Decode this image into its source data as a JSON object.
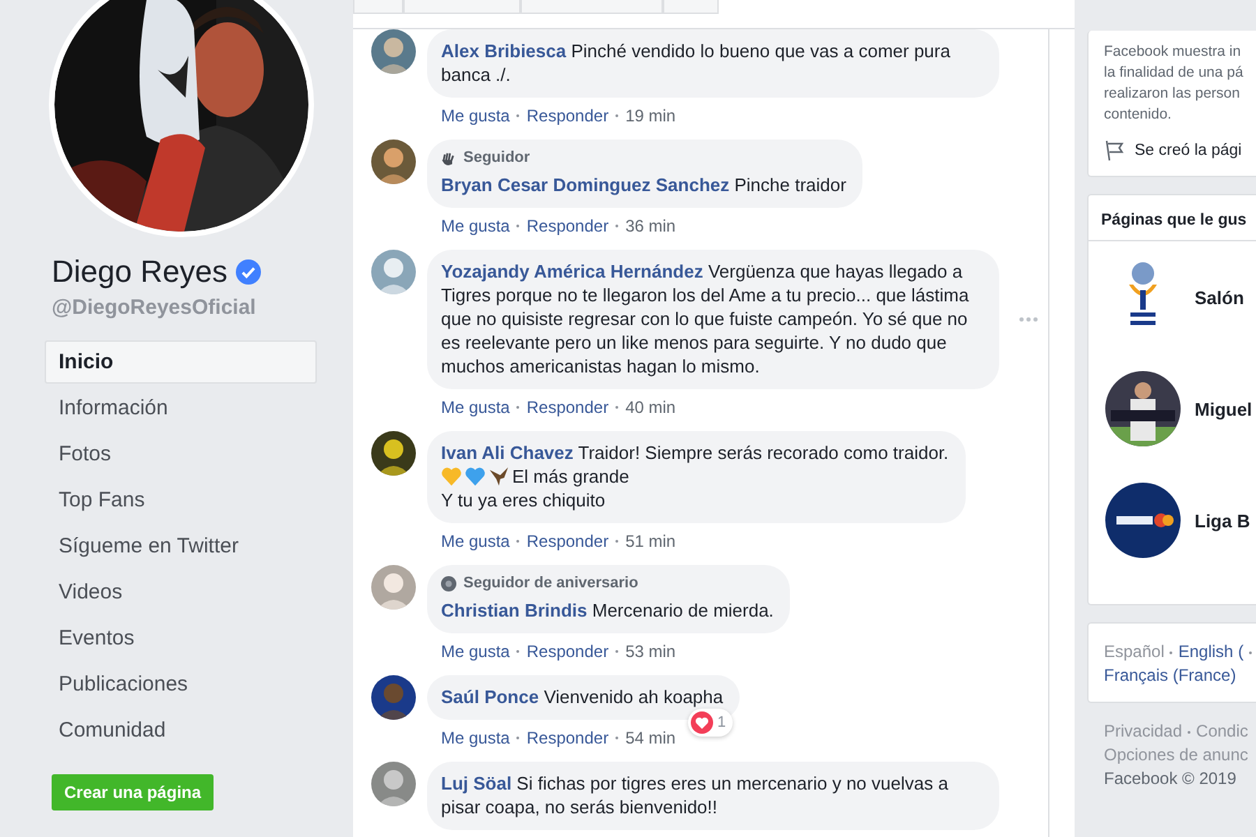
{
  "profile": {
    "kind": "picture",
    "name": "Diego Reyes",
    "verified": true,
    "handle": "@DiegoReyesOficial"
  },
  "nav": [
    {
      "label": "Inicio",
      "selected": true
    },
    {
      "label": "Información",
      "selected": false
    },
    {
      "label": "Fotos",
      "selected": false
    },
    {
      "label": "Top Fans",
      "selected": false
    },
    {
      "label": "Sígueme en Twitter",
      "selected": false
    },
    {
      "label": "Videos",
      "selected": false
    },
    {
      "label": "Eventos",
      "selected": false
    },
    {
      "label": "Publicaciones",
      "selected": false
    },
    {
      "label": "Comunidad",
      "selected": false
    }
  ],
  "create_page_button": "Crear una página",
  "comments": [
    {
      "author": "Alex Bribiesca",
      "text": "Pinché vendido lo bueno que vas a comer pura banca ./.",
      "like": "Me gusta",
      "reply": "Responder",
      "time": "19 min"
    },
    {
      "badge": {
        "kind": "follower",
        "label": "Seguidor"
      },
      "author": "Bryan Cesar Dominguez Sanchez",
      "text": "Pinche traidor",
      "like": "Me gusta",
      "reply": "Responder",
      "time": "36 min"
    },
    {
      "author": "Yozajandy América Hernández",
      "text": "Vergüenza que hayas llegado a Tigres porque no te llegaron los del Ame a tu precio... que lástima que no quisiste regresar con lo que fuiste campeón. Yo sé que no es reelevante pero un like menos para seguirte. Y no dudo que muchos americanistas hagan lo mismo.",
      "like": "Me gusta",
      "reply": "Responder",
      "time": "40 min",
      "more": true
    },
    {
      "author": "Ivan Ali Chavez",
      "text": "Traidor! Siempre serás recorado como traidor.",
      "continuation": [
        {
          "kind": "emoji",
          "text": "El más grande"
        },
        {
          "kind": "plain",
          "text": "Y tu ya eres chiquito"
        }
      ],
      "like": "Me gusta",
      "reply": "Responder",
      "time": "51 min"
    },
    {
      "badge": {
        "kind": "anniversary",
        "label": "Seguidor de aniversario"
      },
      "author": "Christian Brindis",
      "text": "Mercenario de mierda.",
      "like": "Me gusta",
      "reply": "Responder",
      "time": "53 min"
    },
    {
      "author": "Saúl Ponce",
      "text": "Vienvenido ah koapha",
      "like": "Me gusta",
      "reply": "Responder",
      "time": "54 min",
      "reactions": "1"
    },
    {
      "author": "Luj Söal",
      "text": "Si fichas por tigres eres un mercenario y no vuelvas a pisar coapa, no serás bienvenido!!"
    }
  ],
  "info_card": {
    "lines": [
      "Facebook muestra in",
      "la finalidad de una pá",
      "realizaron las person",
      "contenido."
    ],
    "created": "Se creó la pági"
  },
  "liked_pages": {
    "title": "Páginas que le gus",
    "pages": [
      {
        "kind": "logo",
        "name": "Salón"
      },
      {
        "name": "Miguel"
      },
      {
        "kind": "league",
        "name": "Liga B"
      }
    ]
  },
  "languages": [
    {
      "label": "Español",
      "link": false
    },
    {
      "label": "English (",
      "link": true
    },
    {
      "label": "Français (France)",
      "link": true
    }
  ],
  "footer": {
    "links": [
      "Privacidad",
      "Condic"
    ],
    "line2": "Opciones de anunc",
    "copyright": "Facebook © 2019"
  }
}
